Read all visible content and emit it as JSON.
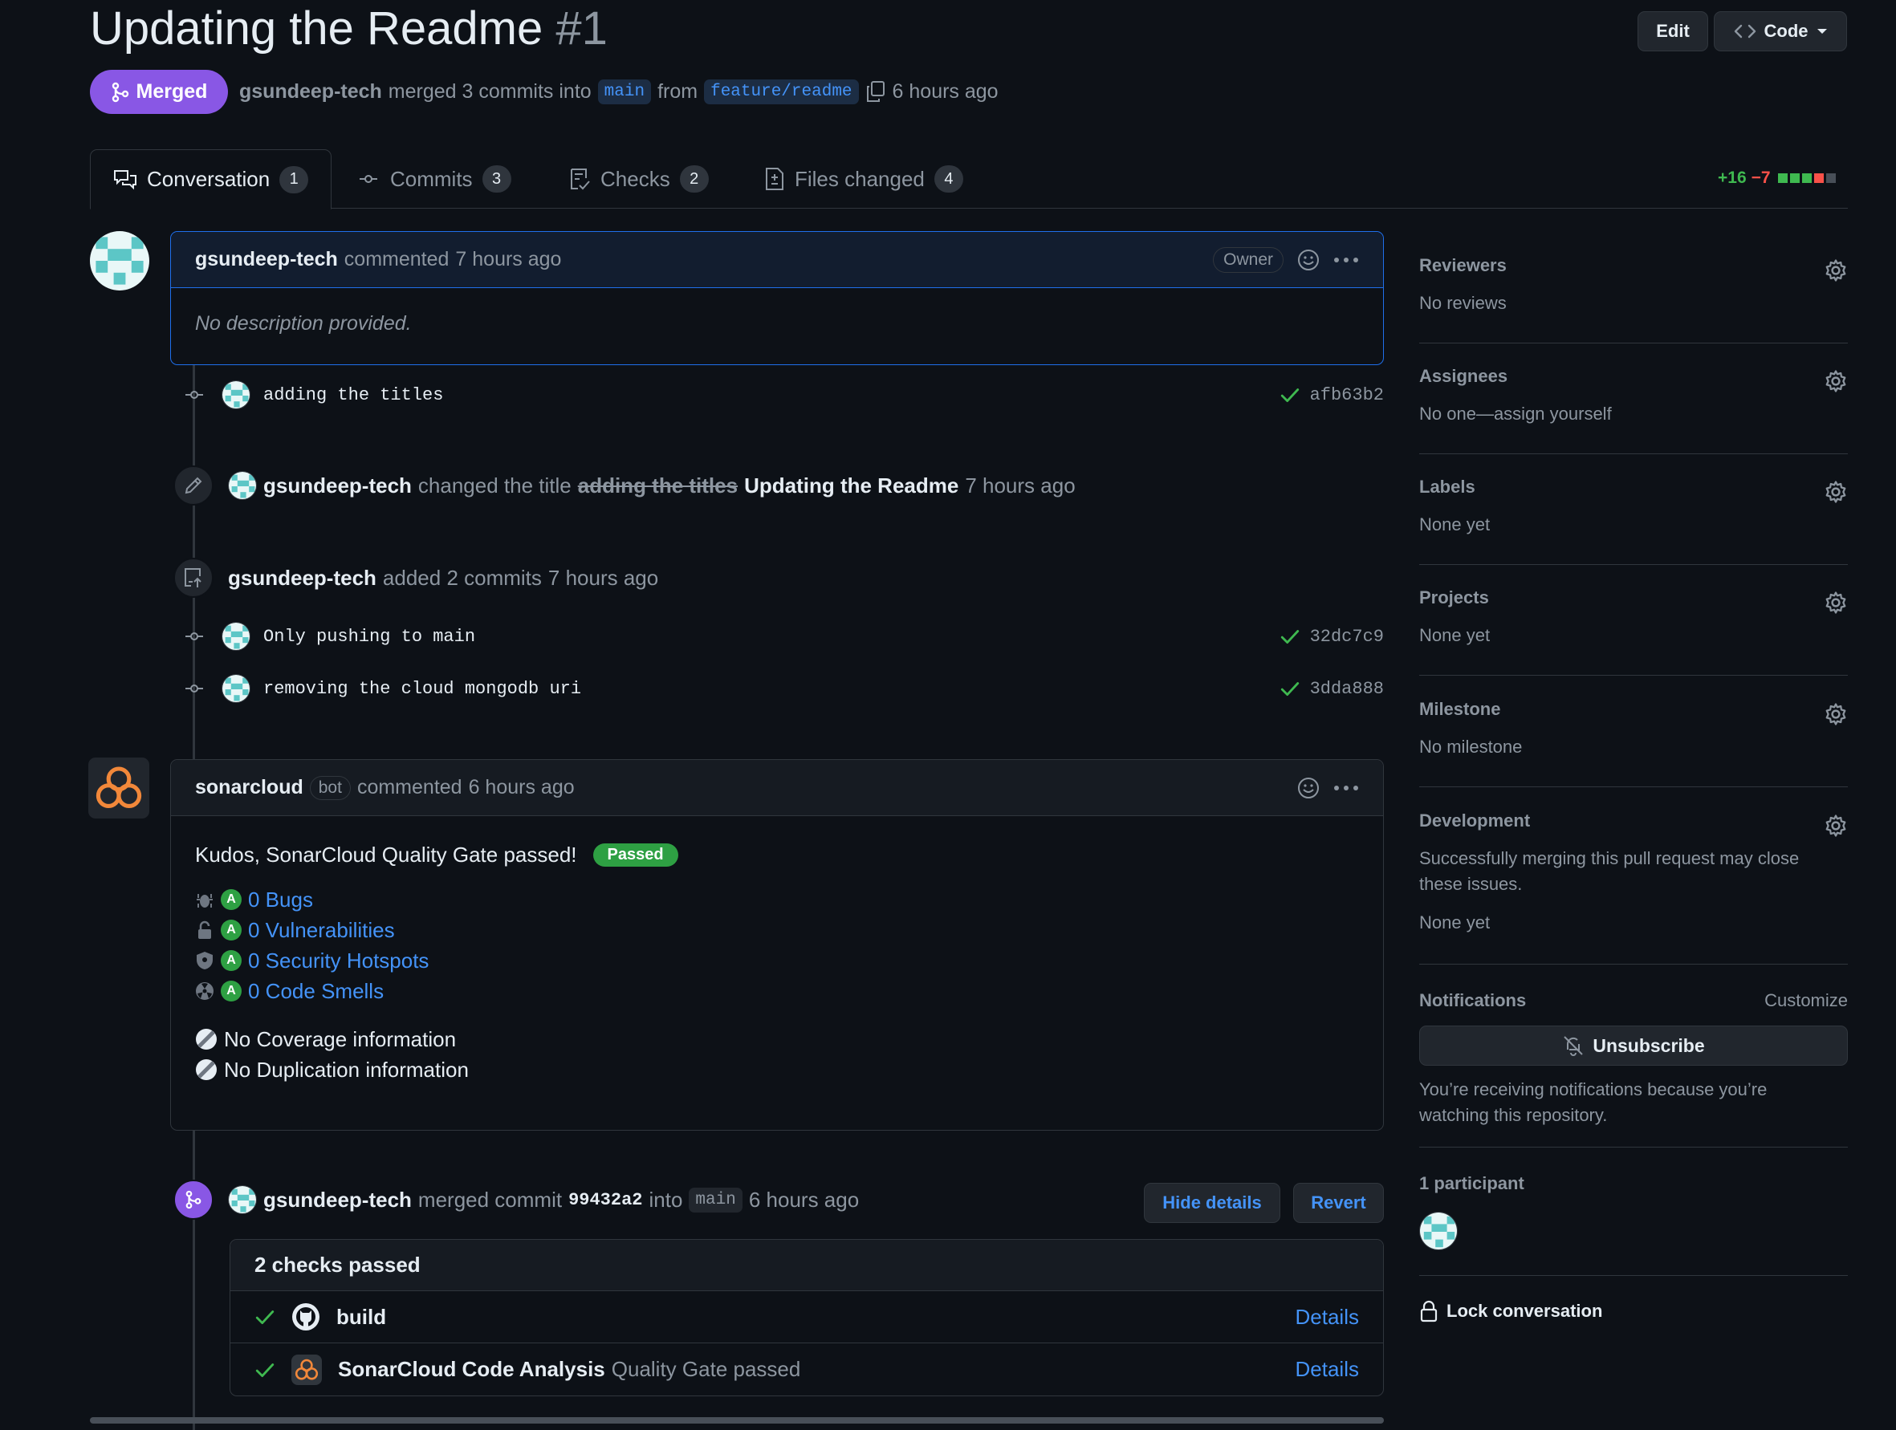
{
  "pr": {
    "title": "Updating the Readme",
    "number": "#1",
    "state": "Merged",
    "author": "gsundeep-tech",
    "merged_text": "merged 3 commits into",
    "base_branch": "main",
    "from_text": "from",
    "head_branch": "feature/readme",
    "time": "6 hours ago"
  },
  "header_buttons": {
    "edit": "Edit",
    "code": "Code"
  },
  "tabs": [
    {
      "label": "Conversation",
      "count": "1"
    },
    {
      "label": "Commits",
      "count": "3"
    },
    {
      "label": "Checks",
      "count": "2"
    },
    {
      "label": "Files changed",
      "count": "4"
    }
  ],
  "diffstat": {
    "additions": "+16",
    "deletions": "−7"
  },
  "first_comment": {
    "author": "gsundeep-tech",
    "action": "commented",
    "time": "7 hours ago",
    "badge": "Owner",
    "body": "No description provided."
  },
  "commits_initial": [
    {
      "message": "adding the titles",
      "sha": "afb63b2"
    }
  ],
  "title_change": {
    "author": "gsundeep-tech",
    "action": "changed the title",
    "old_title": "adding the titles",
    "new_title": "Updating the Readme",
    "time": "7 hours ago"
  },
  "added_commits": {
    "author": "gsundeep-tech",
    "action": "added 2 commits",
    "time": "7 hours ago",
    "commits": [
      {
        "message": "Only pushing to main",
        "sha": "32dc7c9"
      },
      {
        "message": "removing the cloud mongodb uri",
        "sha": "3dda888"
      }
    ]
  },
  "sonar_comment": {
    "author": "sonarcloud",
    "badge": "bot",
    "action": "commented",
    "time": "6 hours ago",
    "headline": "Kudos, SonarCloud Quality Gate passed!",
    "status": "Passed",
    "metrics": [
      {
        "rating": "A",
        "text": "0 Bugs",
        "icon": "bug-icon"
      },
      {
        "rating": "A",
        "text": "0 Vulnerabilities",
        "icon": "lock-icon"
      },
      {
        "rating": "A",
        "text": "0 Security Hotspots",
        "icon": "shield-icon"
      },
      {
        "rating": "A",
        "text": "0 Code Smells",
        "icon": "radiation-icon"
      }
    ],
    "coverage": "No Coverage information",
    "duplication": "No Duplication information"
  },
  "merge_event": {
    "author": "gsundeep-tech",
    "action": "merged commit",
    "sha": "99432a2",
    "into": "into",
    "branch": "main",
    "time": "6 hours ago",
    "hide_details": "Hide details",
    "revert": "Revert"
  },
  "checks": {
    "summary": "2 checks passed",
    "items": [
      {
        "name": "build",
        "description": "",
        "link": "Details"
      },
      {
        "name": "SonarCloud Code Analysis",
        "description": "Quality Gate passed",
        "link": "Details"
      }
    ]
  },
  "sidebar": {
    "reviewers": {
      "title": "Reviewers",
      "value": "No reviews"
    },
    "assignees": {
      "title": "Assignees",
      "value": "No one—assign yourself"
    },
    "labels": {
      "title": "Labels",
      "value": "None yet"
    },
    "projects": {
      "title": "Projects",
      "value": "None yet"
    },
    "milestone": {
      "title": "Milestone",
      "value": "No milestone"
    },
    "development": {
      "title": "Development",
      "value": "Successfully merging this pull request may close these issues.",
      "value2": "None yet"
    },
    "notifications": {
      "title": "Notifications",
      "customize": "Customize",
      "button": "Unsubscribe",
      "note": "You’re receiving notifications because you’re watching this repository."
    },
    "participants": {
      "title": "1 participant"
    },
    "lock": "Lock conversation"
  },
  "colors": {
    "merged": "#8957e5",
    "link": "#4493f8",
    "success": "#3fb950",
    "danger": "#f85149",
    "sonar": "#f2883a"
  }
}
